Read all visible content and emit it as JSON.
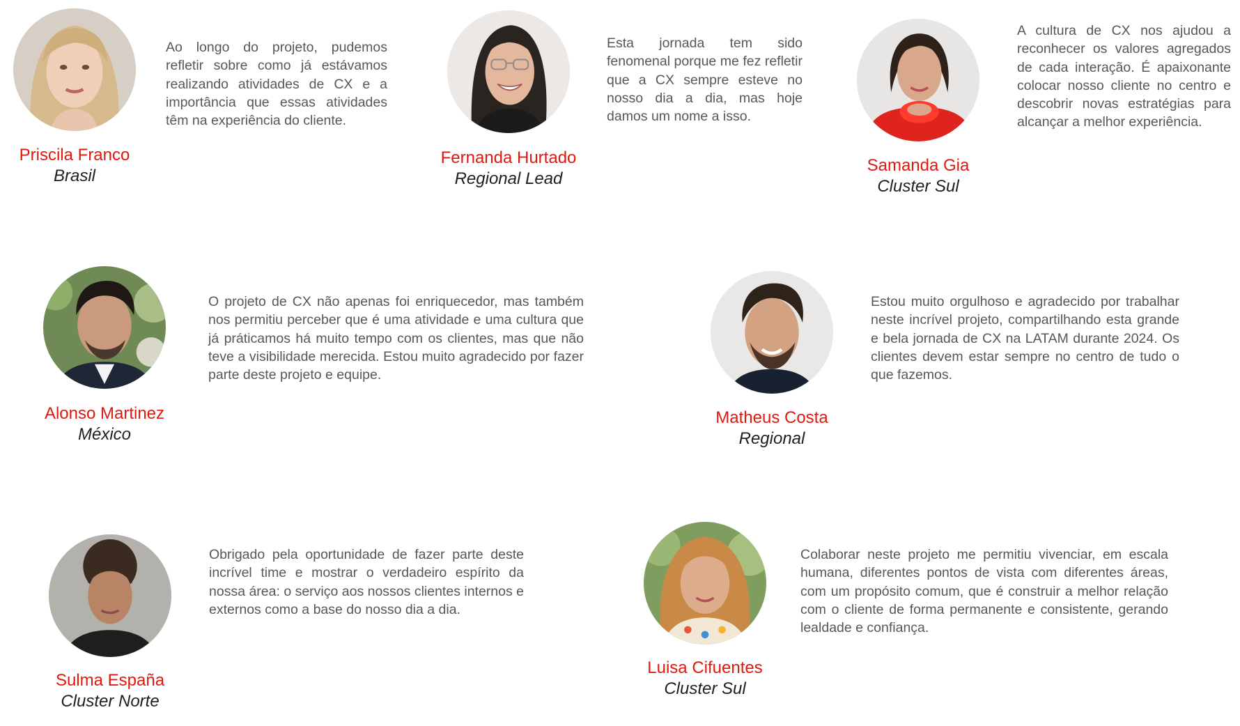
{
  "testimonials": [
    {
      "name": "Priscila Franco",
      "role": "Brasil",
      "quote": "Ao longo do projeto, pudemos refletir sobre como já estávamos realizando atividades de CX e a importância que essas atividades têm na experiência do cliente."
    },
    {
      "name": "Fernanda Hurtado",
      "role": "Regional Lead",
      "quote": "Esta jornada tem sido fenomenal porque me fez refletir que a CX sempre esteve no nosso dia a dia, mas hoje damos um nome a isso."
    },
    {
      "name": "Samanda Gia",
      "role": "Cluster Sul",
      "quote": "A cultura de CX nos ajudou a reconhecer os valores agregados de cada interação. É apaixonante colocar nosso cliente no centro e descobrir novas estratégias para alcançar a melhor experiência."
    },
    {
      "name": "Alonso Martinez",
      "role": "México",
      "quote": "O projeto de CX não apenas foi enriquecedor, mas também nos permitiu perceber que é uma atividade e uma cultura que já práticamos há muito tempo com os clientes, mas que não teve a visibilidade merecida. Estou muito agradecido por fazer parte deste projeto e equipe."
    },
    {
      "name": "Matheus Costa",
      "role": "Regional",
      "quote": "Estou muito orgulhoso e agradecido por trabalhar neste incrível projeto, compartilhando esta grande e bela jornada de CX na LATAM durante 2024. Os clientes devem estar sempre no centro de tudo o que fazemos."
    },
    {
      "name": "Sulma España",
      "role": "Cluster Norte",
      "quote": "Obrigado pela oportunidade de fazer parte deste incrível time e mostrar o verdadeiro espírito da nossa área: o serviço aos nossos clientes internos e externos como a base do nosso dia a dia."
    },
    {
      "name": "Luisa Cifuentes",
      "role": "Cluster Sul",
      "quote": "Colaborar neste projeto me permitiu vivenciar, em escala humana, diferentes pontos de vista com diferentes áreas, com um propósito comum, que é construir a melhor relação com o cliente de forma permanente e consistente, gerando lealdade e confiança."
    }
  ],
  "colors": {
    "name": "#e0190f",
    "role": "#1f1f1f",
    "quote": "#575757"
  }
}
